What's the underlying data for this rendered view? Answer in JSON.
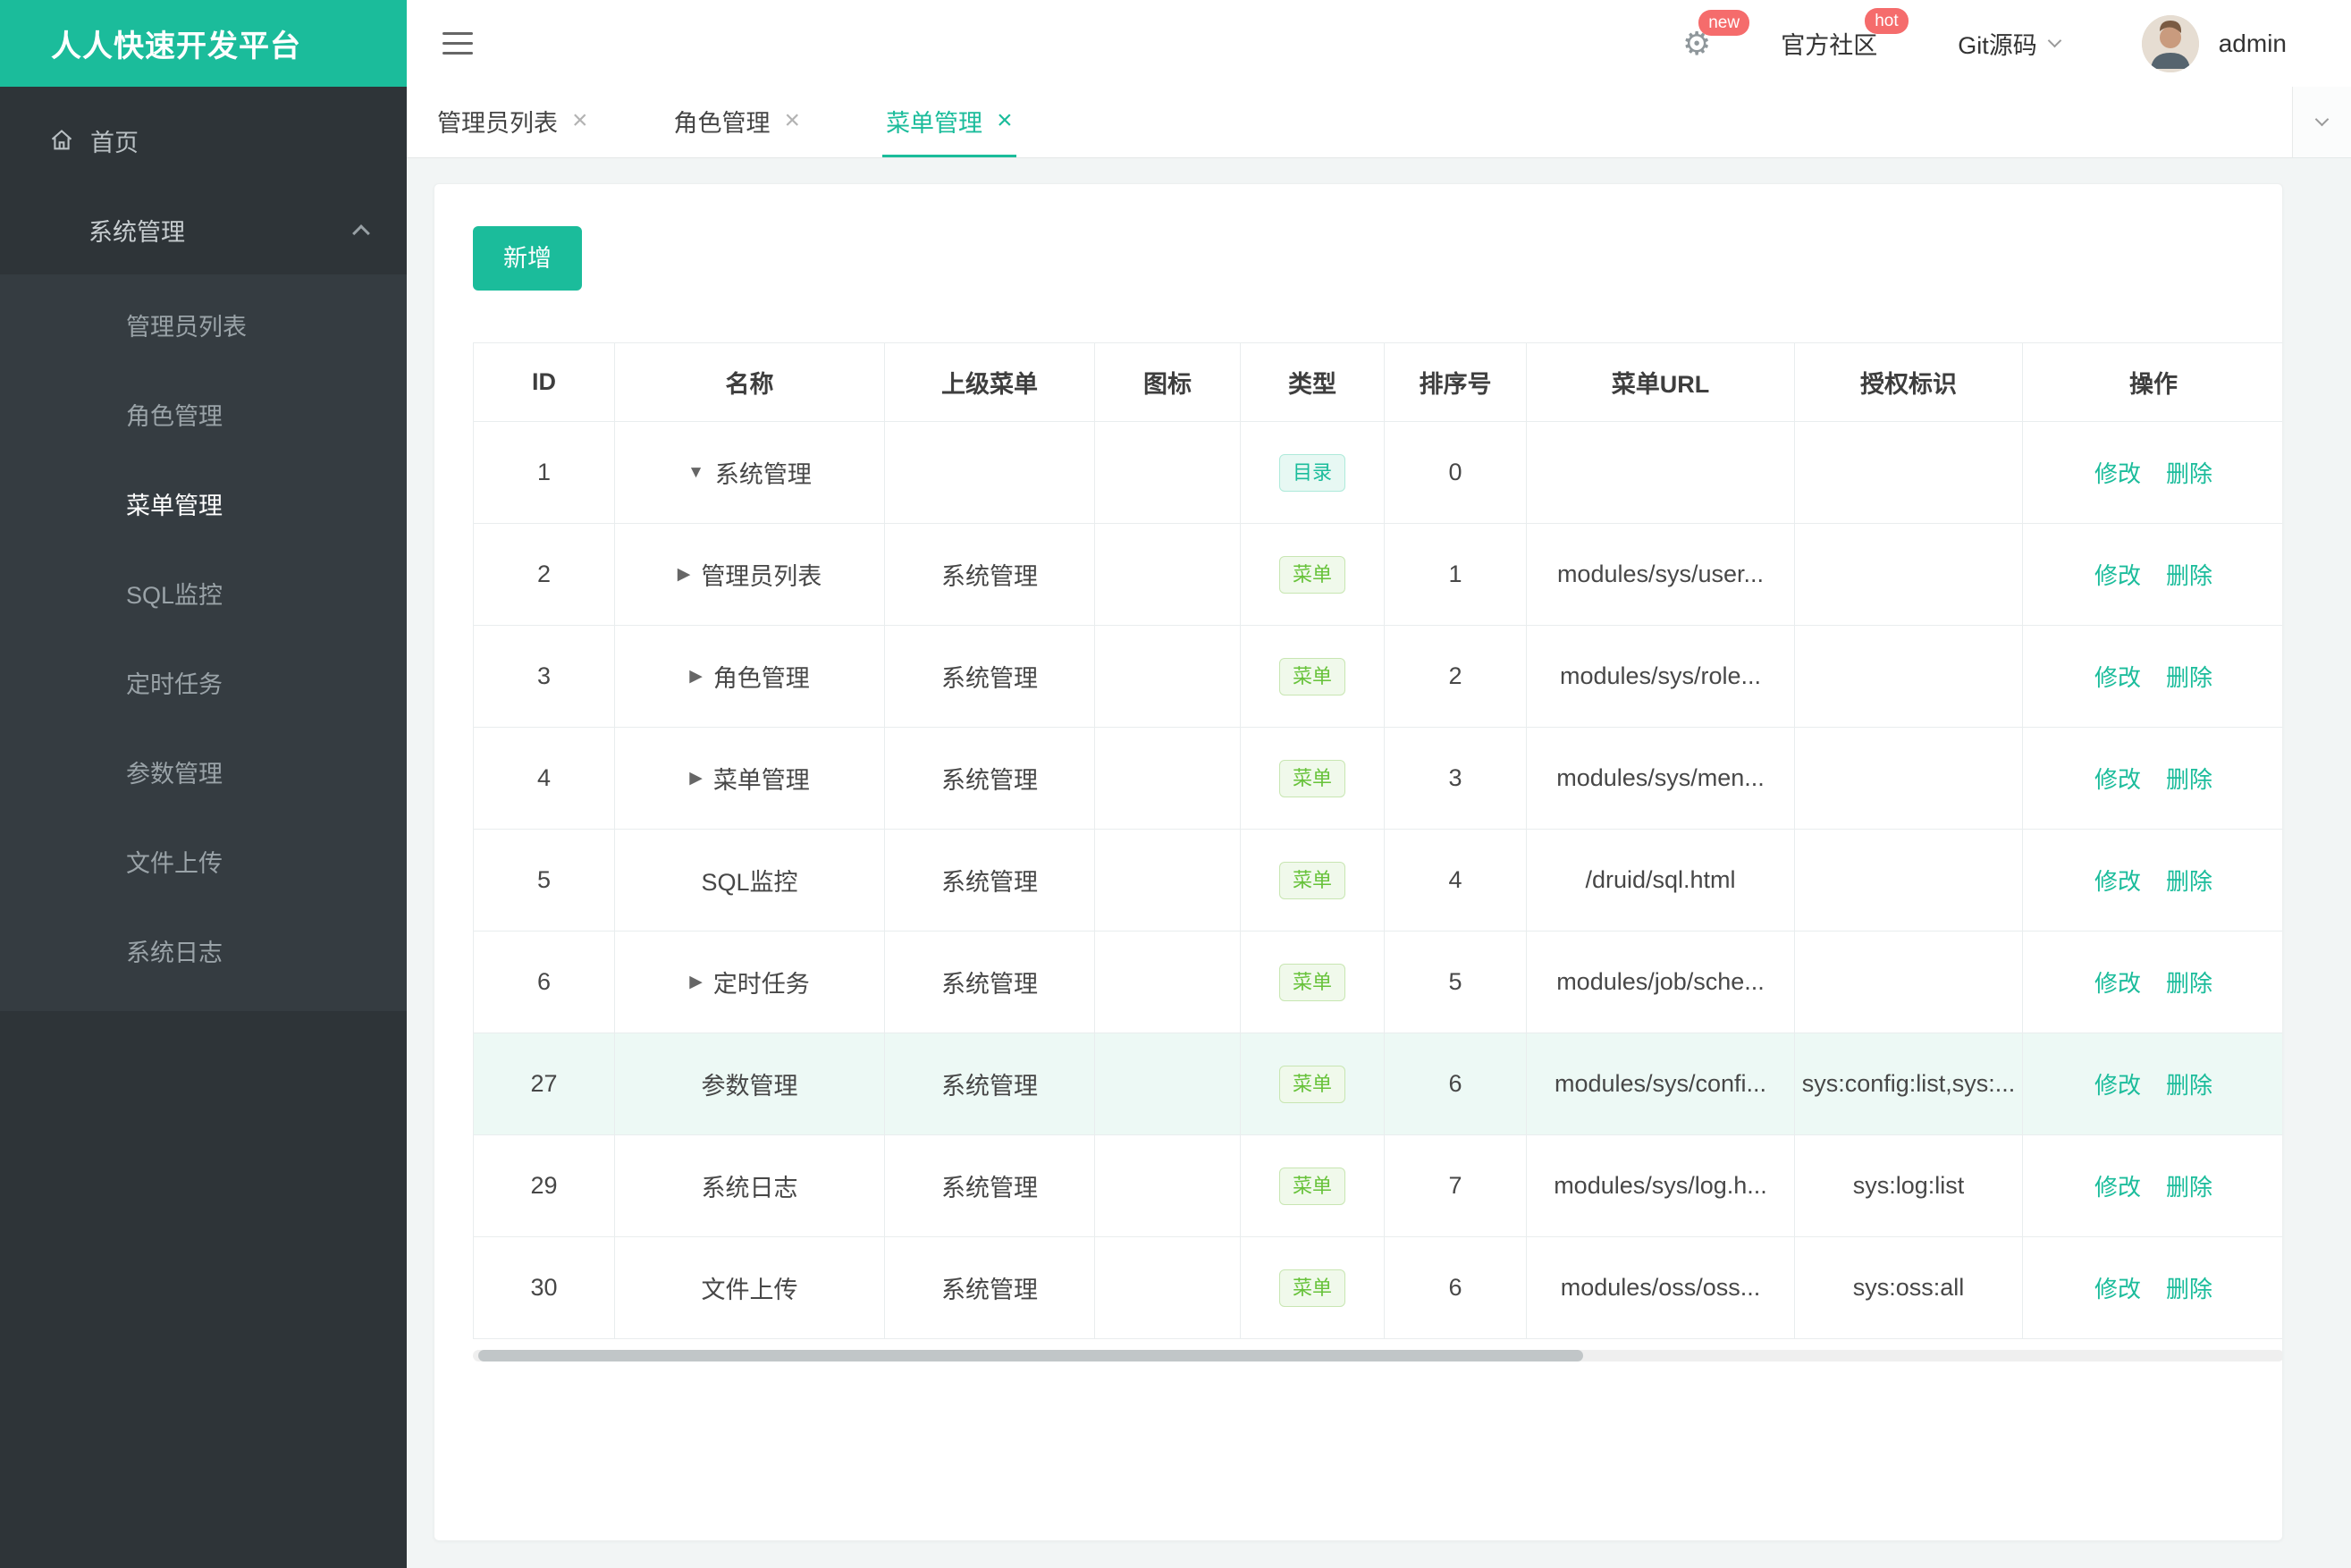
{
  "brand": {
    "title": "人人快速开发平台"
  },
  "topbar": {
    "gear_badge": "new",
    "community_label": "官方社区",
    "community_badge": "hot",
    "git_label": "Git源码",
    "username": "admin"
  },
  "sidebar": {
    "home_label": "首页",
    "group_label": "系统管理",
    "items": [
      {
        "label": "管理员列表",
        "active": false
      },
      {
        "label": "角色管理",
        "active": false
      },
      {
        "label": "菜单管理",
        "active": true
      },
      {
        "label": "SQL监控",
        "active": false
      },
      {
        "label": "定时任务",
        "active": false
      },
      {
        "label": "参数管理",
        "active": false
      },
      {
        "label": "文件上传",
        "active": false
      },
      {
        "label": "系统日志",
        "active": false
      }
    ]
  },
  "tabs": [
    {
      "label": "管理员列表",
      "active": false
    },
    {
      "label": "角色管理",
      "active": false
    },
    {
      "label": "菜单管理",
      "active": true
    }
  ],
  "toolbar": {
    "add_label": "新增"
  },
  "table": {
    "headers": [
      "ID",
      "名称",
      "上级菜单",
      "图标",
      "类型",
      "排序号",
      "菜单URL",
      "授权标识",
      "操作"
    ],
    "edit_label": "修改",
    "delete_label": "删除",
    "rows": [
      {
        "id": "1",
        "arrow": "down",
        "name": "系统管理",
        "parent": "",
        "icon": "",
        "type": "目录",
        "type_kind": "dir",
        "sort": "0",
        "url": "",
        "perms": "",
        "highlight": false
      },
      {
        "id": "2",
        "arrow": "right",
        "name": "管理员列表",
        "parent": "系统管理",
        "icon": "",
        "type": "菜单",
        "type_kind": "menu",
        "sort": "1",
        "url": "modules/sys/user...",
        "perms": "",
        "highlight": false
      },
      {
        "id": "3",
        "arrow": "right",
        "name": "角色管理",
        "parent": "系统管理",
        "icon": "",
        "type": "菜单",
        "type_kind": "menu",
        "sort": "2",
        "url": "modules/sys/role...",
        "perms": "",
        "highlight": false
      },
      {
        "id": "4",
        "arrow": "right",
        "name": "菜单管理",
        "parent": "系统管理",
        "icon": "",
        "type": "菜单",
        "type_kind": "menu",
        "sort": "3",
        "url": "modules/sys/men...",
        "perms": "",
        "highlight": false
      },
      {
        "id": "5",
        "arrow": "",
        "name": "SQL监控",
        "parent": "系统管理",
        "icon": "",
        "type": "菜单",
        "type_kind": "menu",
        "sort": "4",
        "url": "/druid/sql.html",
        "perms": "",
        "highlight": false
      },
      {
        "id": "6",
        "arrow": "right",
        "name": "定时任务",
        "parent": "系统管理",
        "icon": "",
        "type": "菜单",
        "type_kind": "menu",
        "sort": "5",
        "url": "modules/job/sche...",
        "perms": "",
        "highlight": false
      },
      {
        "id": "27",
        "arrow": "",
        "name": "参数管理",
        "parent": "系统管理",
        "icon": "",
        "type": "菜单",
        "type_kind": "menu",
        "sort": "6",
        "url": "modules/sys/confi...",
        "perms": "sys:config:list,sys:...",
        "highlight": true
      },
      {
        "id": "29",
        "arrow": "",
        "name": "系统日志",
        "parent": "系统管理",
        "icon": "",
        "type": "菜单",
        "type_kind": "menu",
        "sort": "7",
        "url": "modules/sys/log.h...",
        "perms": "sys:log:list",
        "highlight": false
      },
      {
        "id": "30",
        "arrow": "",
        "name": "文件上传",
        "parent": "系统管理",
        "icon": "",
        "type": "菜单",
        "type_kind": "menu",
        "sort": "6",
        "url": "modules/oss/oss...",
        "perms": "sys:oss:all",
        "highlight": false
      }
    ]
  },
  "colors": {
    "brand_teal": "#1bbc9b",
    "badge_red": "#f56c6c",
    "tag_dir": "#1bbc9b",
    "tag_menu": "#67c23a",
    "sidebar_bg": "#2e3438",
    "row_highlight": "#edf9f5"
  }
}
